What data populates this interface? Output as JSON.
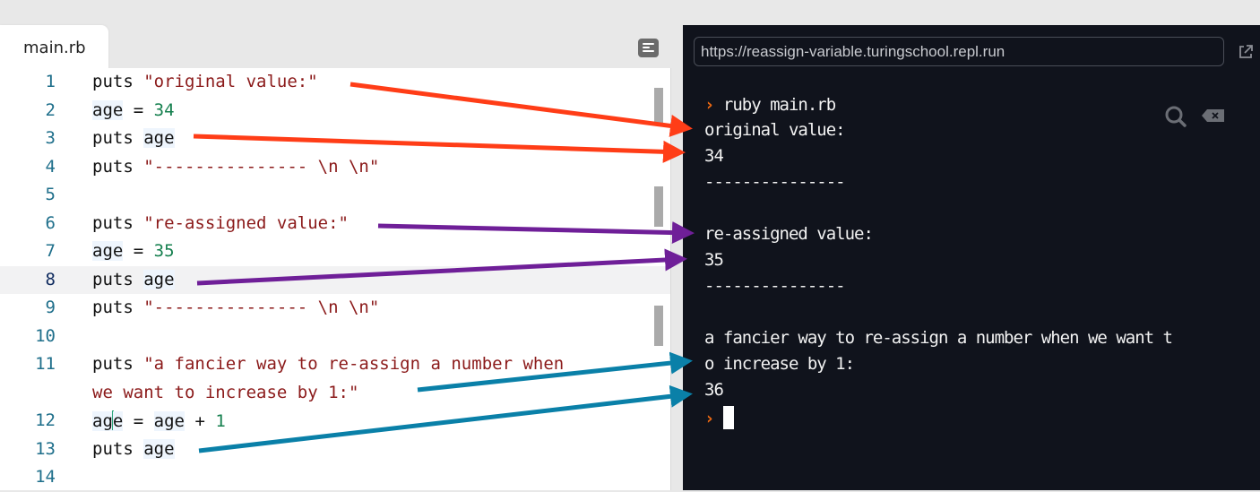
{
  "editor": {
    "tab_label": "main.rb",
    "format_button_icon": "format-lines-icon",
    "active_line": 8,
    "lines": [
      {
        "num": "1",
        "parts": [
          {
            "t": "puts ",
            "c": "kw"
          },
          {
            "t": "\"original value:\"",
            "c": "str"
          }
        ]
      },
      {
        "num": "2",
        "parts": [
          {
            "t": "age",
            "c": "hl"
          },
          {
            "t": " = ",
            "c": "kw"
          },
          {
            "t": "34",
            "c": "num"
          }
        ]
      },
      {
        "num": "3",
        "parts": [
          {
            "t": "puts ",
            "c": "kw"
          },
          {
            "t": "age",
            "c": "hl"
          }
        ]
      },
      {
        "num": "4",
        "parts": [
          {
            "t": "puts ",
            "c": "kw"
          },
          {
            "t": "\"--------------- \\n \\n\"",
            "c": "str"
          }
        ]
      },
      {
        "num": "5",
        "parts": []
      },
      {
        "num": "6",
        "parts": [
          {
            "t": "puts ",
            "c": "kw"
          },
          {
            "t": "\"re-assigned value:\"",
            "c": "str"
          }
        ]
      },
      {
        "num": "7",
        "parts": [
          {
            "t": "age",
            "c": "hl"
          },
          {
            "t": " = ",
            "c": "kw"
          },
          {
            "t": "35",
            "c": "num"
          }
        ]
      },
      {
        "num": "8",
        "parts": [
          {
            "t": "puts ",
            "c": "kw"
          },
          {
            "t": "age",
            "c": "hl"
          }
        ]
      },
      {
        "num": "9",
        "parts": [
          {
            "t": "puts ",
            "c": "kw"
          },
          {
            "t": "\"--------------- \\n \\n\"",
            "c": "str"
          }
        ]
      },
      {
        "num": "10",
        "parts": []
      },
      {
        "num": "11",
        "parts": [
          {
            "t": "puts ",
            "c": "kw"
          },
          {
            "t": "\"a fancier way to re-assign a number when",
            "c": "str"
          }
        ]
      },
      {
        "num": "",
        "parts": [
          {
            "t": "we want to increase by 1:\"",
            "c": "str"
          }
        ]
      },
      {
        "num": "12",
        "parts": [
          {
            "t": "ag",
            "c": "hl"
          },
          {
            "t": "|",
            "c": "cursor"
          },
          {
            "t": "e",
            "c": "hl"
          },
          {
            "t": " = ",
            "c": "kw"
          },
          {
            "t": "age",
            "c": "hl"
          },
          {
            "t": " + ",
            "c": "kw"
          },
          {
            "t": "1",
            "c": "num"
          }
        ]
      },
      {
        "num": "13",
        "parts": [
          {
            "t": "puts ",
            "c": "kw"
          },
          {
            "t": "age",
            "c": "hl"
          }
        ]
      },
      {
        "num": "14",
        "parts": []
      }
    ]
  },
  "terminal": {
    "url": "https://reassign-variable.turingschool.repl.run",
    "popout_icon": "external-link-icon",
    "search_icon": "search-icon",
    "clear_icon": "clear-console-icon",
    "prompt_symbol": "›",
    "command": "ruby main.rb",
    "output_lines": [
      "original value:",
      "34",
      "---------------",
      "",
      "re-assigned value:",
      "35",
      "---------------",
      "",
      "a fancier way to re-assign a number when we want t",
      "o increase by 1:",
      "36"
    ]
  },
  "annotations": {
    "colors": {
      "red": "#ff3d17",
      "purple": "#6f1f98",
      "blue": "#0a80a8"
    },
    "arrows": [
      {
        "color": "red",
        "from": "editor line 1 string",
        "to": "terminal 'original value:'"
      },
      {
        "color": "red",
        "from": "editor line 3 age",
        "to": "terminal '34'"
      },
      {
        "color": "purple",
        "from": "editor line 6 string",
        "to": "terminal 're-assigned value:'"
      },
      {
        "color": "purple",
        "from": "editor line 8 age",
        "to": "terminal '35'"
      },
      {
        "color": "blue",
        "from": "editor line 11 string",
        "to": "terminal 'o increase by 1:'"
      },
      {
        "color": "blue",
        "from": "editor line 13 age",
        "to": "terminal '36'"
      }
    ]
  }
}
